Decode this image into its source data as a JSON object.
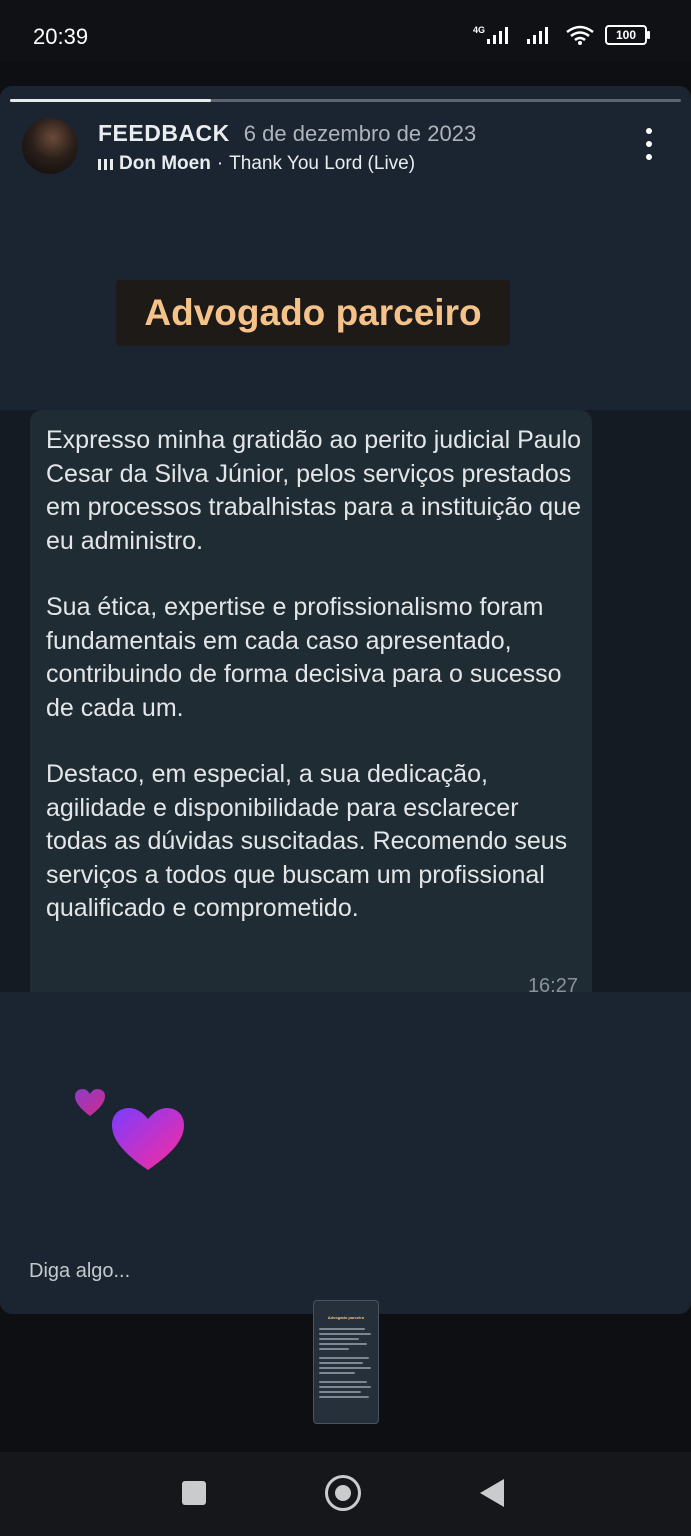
{
  "status": {
    "time": "20:39",
    "network": "4G",
    "battery": "100"
  },
  "story": {
    "progress": 0.3,
    "profile_name": "FEEDBACK",
    "date": "6 de dezembro de 2023",
    "music_artist": "Don Moen",
    "music_sep": "·",
    "music_song": "Thank You Lord (Live)",
    "caption": "Advogado parceiro",
    "reply_placeholder": "Diga algo..."
  },
  "message": {
    "paragraphs": [
      "Expresso minha gratidão ao perito judicial Paulo Cesar da Silva Júnior, pelos serviços prestados em processos trabalhistas para a instituição que eu administro.",
      "Sua ética, expertise e profissionalismo foram fundamentais em cada caso apresentado, contribuindo de forma decisiva para o sucesso de cada um.",
      "Destaco, em especial, a sua dedicação, agilidade e disponibilidade para esclarecer todas as dúvidas suscitadas. Recomendo seus serviços a todos que buscam um profissional qualificado e comprometido."
    ],
    "time": "16:27"
  },
  "thumbnail": {
    "caption": "Advogado parceiro"
  },
  "colors": {
    "card_bg": "#1b2431",
    "bubble_bg": "#202c33",
    "caption_text": "#f5c28a",
    "heart_gradient_start": "#7b3cff",
    "heart_gradient_end": "#ff2a9a"
  },
  "icons": [
    "signal-icon",
    "wifi-icon",
    "battery-icon",
    "equalizer-icon",
    "more-options-icon",
    "heart-icon",
    "recents-icon",
    "home-icon",
    "back-icon"
  ]
}
